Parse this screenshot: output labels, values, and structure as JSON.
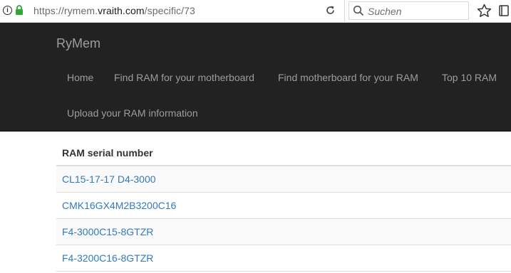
{
  "browser": {
    "url_prefix": "https://rymem.",
    "url_domain": "vraith.com",
    "url_path": "/specific/73",
    "search_placeholder": "Suchen"
  },
  "navbar": {
    "brand": "RyMem",
    "links": [
      {
        "label": "Home"
      },
      {
        "label": "Find RAM for your motherboard"
      },
      {
        "label": "Find motherboard for your RAM"
      },
      {
        "label": "Top 10 RAM"
      },
      {
        "label": "Upload your RAM information"
      }
    ]
  },
  "table": {
    "header": "RAM serial number",
    "rows": [
      {
        "serial": "CL15-17-17 D4-3000"
      },
      {
        "serial": "CMK16GX4M2B3200C16"
      },
      {
        "serial": "F4-3000C15-8GTZR"
      },
      {
        "serial": "F4-3200C16-8GTZR"
      }
    ]
  },
  "colors": {
    "navbar_bg": "#222222",
    "nav_text": "#9d9d9d",
    "link": "#337ab7",
    "lock_green": "#2fa936"
  }
}
